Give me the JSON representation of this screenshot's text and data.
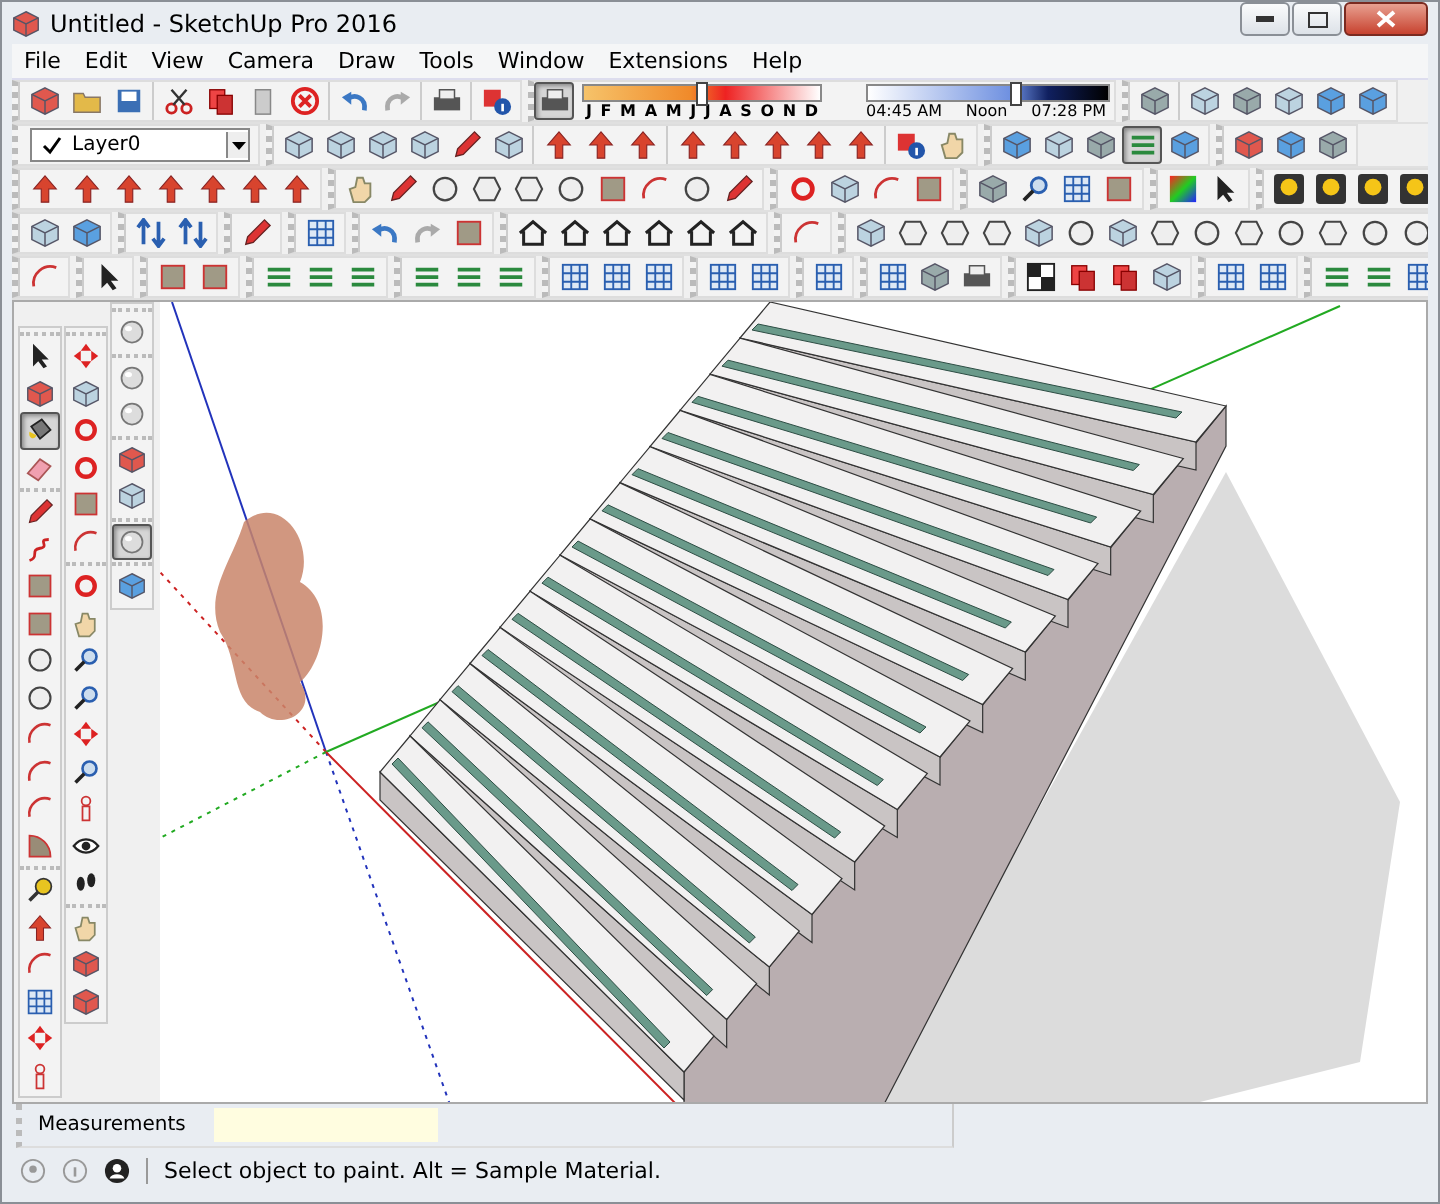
{
  "window": {
    "title": "Untitled - SketchUp Pro 2016"
  },
  "menu": [
    "File",
    "Edit",
    "View",
    "Camera",
    "Draw",
    "Tools",
    "Window",
    "Extensions",
    "Help"
  ],
  "shadows": {
    "selected": true,
    "months": [
      "J",
      "F",
      "M",
      "A",
      "M",
      "J",
      "J",
      "A",
      "S",
      "O",
      "N",
      "D"
    ],
    "date_slider": {
      "level": 0.5
    },
    "time_start": "04:45 AM",
    "time_mid": "Noon",
    "time_end": "07:28 PM",
    "time_slider": {
      "level": 0.62
    }
  },
  "layers": {
    "checked": true,
    "current": "Layer0"
  },
  "styles_toolbar": [
    {
      "selected": false
    },
    {
      "selected": false
    },
    {
      "selected": false
    },
    {
      "selected": true
    },
    {
      "selected": false
    }
  ],
  "tool_palette": {
    "column_1": [
      {
        "selected": false
      },
      {
        "selected": false
      },
      {
        "selected": true
      },
      {
        "selected": false
      },
      {
        "selected": false
      },
      {
        "selected": false
      },
      {
        "selected": false
      },
      {
        "selected": false
      },
      {
        "selected": false
      },
      {
        "selected": false
      },
      {
        "selected": false
      },
      {
        "selected": false
      },
      {
        "selected": false
      },
      {
        "selected": false
      },
      {
        "selected": false
      },
      {
        "selected": false
      },
      {
        "selected": false
      },
      {
        "selected": false
      },
      {
        "selected": false
      },
      {
        "selected": false
      }
    ],
    "column_2": [
      {
        "selected": false
      },
      {
        "selected": false
      },
      {
        "selected": false
      },
      {
        "selected": false
      },
      {
        "selected": false
      },
      {
        "selected": false
      },
      {
        "selected": false
      },
      {
        "selected": false
      },
      {
        "selected": false
      },
      {
        "selected": false
      },
      {
        "selected": false
      },
      {
        "selected": false
      },
      {
        "selected": false
      },
      {
        "selected": false
      },
      {
        "selected": false
      },
      {
        "selected": false
      },
      {
        "selected": false
      },
      {
        "selected": false
      }
    ],
    "column_3": [
      {
        "selected": false
      },
      {
        "selected": false
      },
      {
        "selected": false
      },
      {
        "selected": false
      },
      {
        "selected": false
      },
      {
        "selected": true
      },
      {
        "selected": false
      }
    ]
  },
  "measurements": {
    "label": "Measurements"
  },
  "status_bar": {
    "message": "Select object to paint. Alt = Sample Material."
  }
}
